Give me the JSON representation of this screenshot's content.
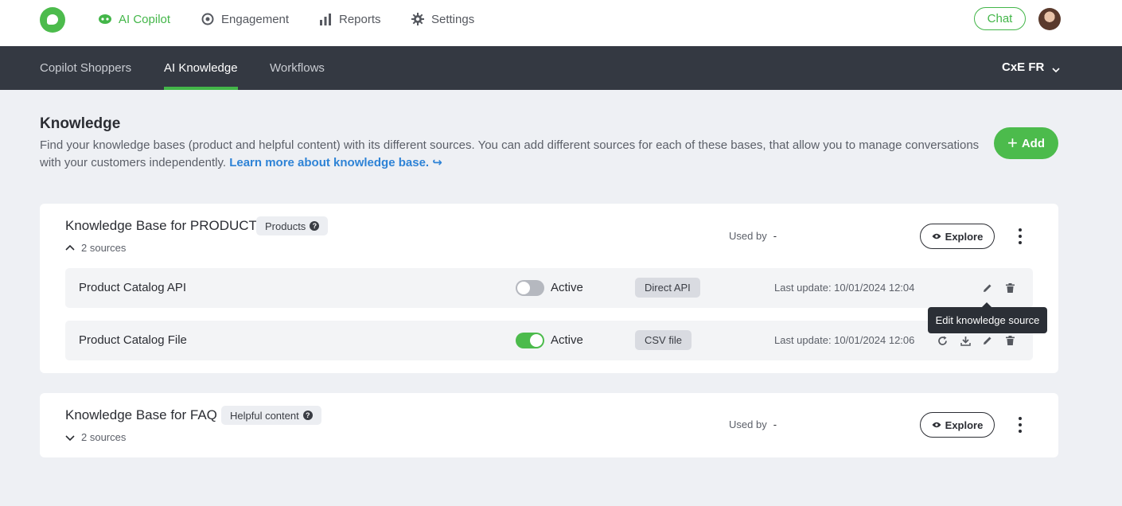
{
  "top_nav": {
    "items": [
      {
        "label": "AI Copilot",
        "icon": "copilot-icon",
        "active": true
      },
      {
        "label": "Engagement",
        "icon": "target-icon",
        "active": false
      },
      {
        "label": "Reports",
        "icon": "bar-chart-icon",
        "active": false
      },
      {
        "label": "Settings",
        "icon": "gear-icon",
        "active": false
      }
    ],
    "chat_label": "Chat"
  },
  "sub_nav": {
    "tabs": [
      {
        "label": "Copilot Shoppers",
        "active": false
      },
      {
        "label": "AI Knowledge",
        "active": true
      },
      {
        "label": "Workflows",
        "active": false
      }
    ],
    "org_label": "CxE FR"
  },
  "header": {
    "title": "Knowledge",
    "description": "Find your knowledge bases (product and helpful content) with its different sources. You can add different sources for each of these bases, that allow you to manage conversations with your customers independently.",
    "learn_more": "Learn more about knowledge base. ↪",
    "add_label": "Add"
  },
  "knowledge_bases": [
    {
      "title": "Knowledge Base for PRODUCT",
      "tag": "Products",
      "sources_label": "2 sources",
      "expanded": true,
      "used_by_label": "Used by",
      "used_by_value": "-",
      "explore_label": "Explore",
      "sources": [
        {
          "name": "Product Catalog API",
          "active": false,
          "status_label": "Active",
          "type": "Direct API",
          "last_update": "Last update: 10/01/2024 12:04"
        },
        {
          "name": "Product Catalog File",
          "active": true,
          "status_label": "Active",
          "type": "CSV file",
          "last_update": "Last update: 10/01/2024 12:06"
        }
      ]
    },
    {
      "title": "Knowledge Base for FAQ",
      "tag": "Helpful content",
      "sources_label": "2 sources",
      "expanded": false,
      "used_by_label": "Used by",
      "used_by_value": "-",
      "explore_label": "Explore"
    }
  ],
  "tooltip": "Edit knowledge source",
  "colors": {
    "brand_green": "#4cbb4c",
    "subnav_bg": "#343942",
    "link_blue": "#2e83d6"
  }
}
